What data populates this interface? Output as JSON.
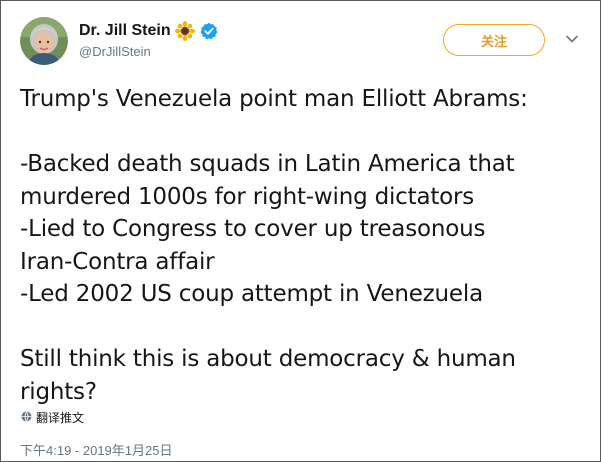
{
  "profile": {
    "display_name": "Dr. Jill Stein",
    "handle": "@DrJillStein",
    "emoji_icon": "sunflower-icon",
    "verified_icon": "verified-badge-icon"
  },
  "follow_button": {
    "label": "关注"
  },
  "tweet": {
    "lines": [
      "Trump's Venezuela point man Elliott Abrams:",
      "",
      "-Backed death squads in Latin America that",
      "murdered 1000s for right-wing dictators",
      "-Lied to Congress to cover up treasonous",
      "Iran-Contra affair",
      "-Led 2002 US coup attempt in Venezuela",
      "",
      "Still think this is about democracy & human",
      "rights?"
    ]
  },
  "translate": {
    "label": "翻译推文",
    "icon": "globe-icon"
  },
  "timestamp": "下午4:19 - 2019年1月25日",
  "colors": {
    "text": "#14171a",
    "secondary_text": "#657786",
    "follow_accent": "#f5a623",
    "verified": "#1da1f2"
  }
}
